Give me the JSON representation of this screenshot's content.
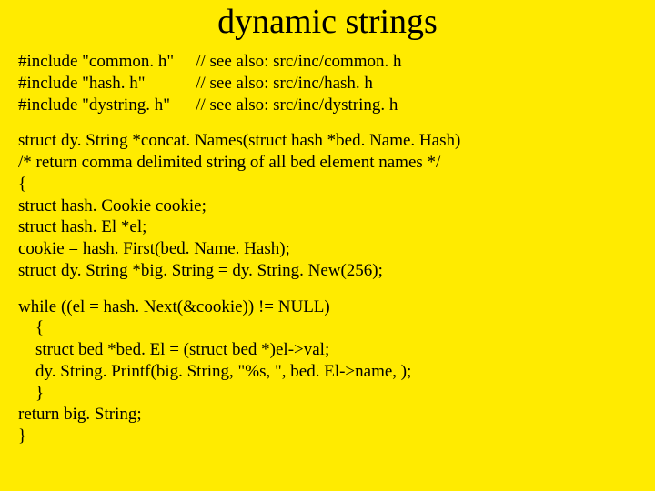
{
  "title": "dynamic strings",
  "includes": [
    {
      "directive": "#include \"common. h\"",
      "comment": "// see also: src/inc/common. h"
    },
    {
      "directive": "#include \"hash. h\"",
      "comment": "// see also: src/inc/hash. h"
    },
    {
      "directive": "#include \"dystring. h\"",
      "comment": "// see also: src/inc/dystring. h"
    }
  ],
  "code_block_1": "struct dy. String *concat. Names(struct hash *bed. Name. Hash)\n/* return comma delimited string of all bed element names */\n{\nstruct hash. Cookie cookie;\nstruct hash. El *el;\ncookie = hash. First(bed. Name. Hash);\nstruct dy. String *big. String = dy. String. New(256);",
  "code_block_2": "while ((el = hash. Next(&cookie)) != NULL)\n    {\n    struct bed *bed. El = (struct bed *)el->val;\n    dy. String. Printf(big. String, \"%s, \", bed. El->name, );\n    }\nreturn big. String;\n}"
}
